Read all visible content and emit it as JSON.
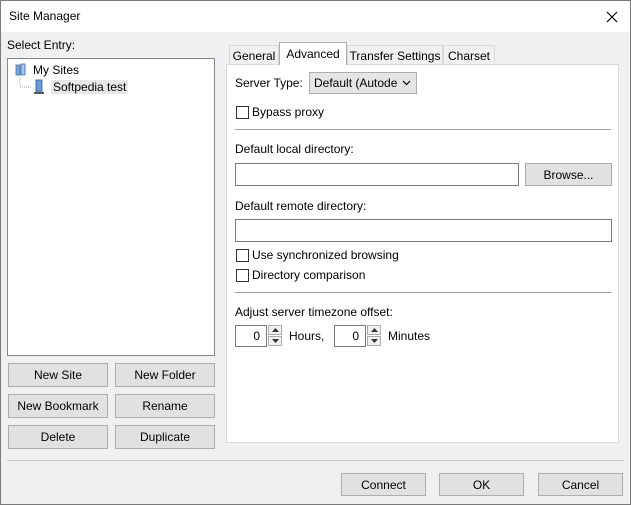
{
  "window": {
    "title": "Site Manager"
  },
  "left": {
    "label": "Select Entry:",
    "tree": [
      {
        "label": "My Sites"
      },
      {
        "label": "Softpedia test"
      }
    ],
    "buttons": {
      "new_site": "New Site",
      "new_folder": "New Folder",
      "new_bookmark": "New Bookmark",
      "rename": "Rename",
      "delete": "Delete",
      "duplicate": "Duplicate"
    }
  },
  "tabs": [
    {
      "label": "General"
    },
    {
      "label": "Advanced"
    },
    {
      "label": "Transfer Settings"
    },
    {
      "label": "Charset"
    }
  ],
  "advanced": {
    "server_type_label": "Server Type:",
    "server_type_value": "Default (Autode",
    "bypass_proxy": "Bypass proxy",
    "local_dir_label": "Default local directory:",
    "local_dir_value": "",
    "browse": "Browse...",
    "remote_dir_label": "Default remote directory:",
    "remote_dir_value": "",
    "sync_browsing": "Use synchronized browsing",
    "dir_comparison": "Directory comparison",
    "timezone_label": "Adjust server timezone offset:",
    "hours_value": "0",
    "hours_label": "Hours,",
    "minutes_value": "0",
    "minutes_label": "Minutes"
  },
  "footer": {
    "connect": "Connect",
    "ok": "OK",
    "cancel": "Cancel"
  }
}
